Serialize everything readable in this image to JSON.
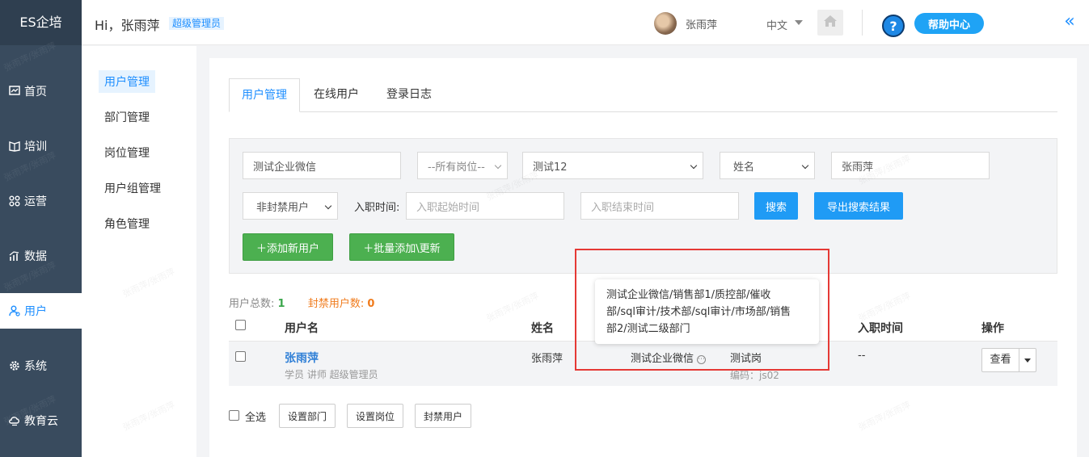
{
  "sidebar": {
    "brand": "ES企培",
    "items": [
      {
        "label": "首页",
        "icon": "dashboard-icon"
      },
      {
        "label": "培训",
        "icon": "training-icon"
      },
      {
        "label": "运营",
        "icon": "operations-icon"
      },
      {
        "label": "数据",
        "icon": "data-chart-icon"
      },
      {
        "label": "用户",
        "icon": "user-icon"
      },
      {
        "label": "系统",
        "icon": "gear-icon"
      },
      {
        "label": "教育云",
        "icon": "cloud-icon"
      }
    ],
    "active_index": 4
  },
  "header": {
    "greeting": "Hi，张雨萍",
    "role_tag": "超级管理员",
    "username": "张雨萍",
    "language": "中文",
    "help_label": "帮助中心",
    "help_icon_glyph": "?",
    "collapse_glyph": "«"
  },
  "submenu": {
    "items": [
      "用户管理",
      "部门管理",
      "岗位管理",
      "用户组管理",
      "角色管理"
    ],
    "active_index": 0
  },
  "tabs": [
    "用户管理",
    "在线用户",
    "登录日志"
  ],
  "filters": {
    "department": "测试企业微信",
    "position": "--所有岗位--",
    "group": "测试12",
    "search_field": "姓名",
    "keyword": "张雨萍",
    "ban_status": "非封禁用户",
    "hire_label": "入职时间:",
    "hire_start_placeholder": "入职起始时间",
    "hire_end_placeholder": "入职结束时间",
    "search_button": "搜索",
    "export_button": "导出搜索结果",
    "add_user_button": "＋添加新用户",
    "batch_add_button": "＋批量添加\\更新"
  },
  "summary": {
    "total_label": "用户总数:",
    "total_count": "1",
    "banned_label": "封禁用户数:",
    "banned_count": "0"
  },
  "table": {
    "headers": [
      "用户名",
      "姓名",
      "入职时间",
      "操作"
    ],
    "rows": [
      {
        "username": "张雨萍",
        "roles": "学员   讲师   超级管理员",
        "name": "张雨萍",
        "department": "测试企业微信",
        "position": "测试岗",
        "position_code": "编码：js02",
        "hire_date": "--",
        "action": "查看"
      }
    ]
  },
  "bulk_actions": {
    "select_all": "全选",
    "set_department": "设置部门",
    "set_position": "设置岗位",
    "ban_user": "封禁用户"
  },
  "tooltip": {
    "lines": [
      "测试企业微信/销售部1/质控部/催收",
      "部/sql审计/技术部/sql审计/市场部/销售",
      "部2/测试二级部门"
    ]
  },
  "watermark": "张雨萍/张雨萍",
  "colors": {
    "sidebar": "#394b5e",
    "accent": "#1f8fff",
    "green": "#4cb050",
    "highlight_box": "#e53935"
  }
}
